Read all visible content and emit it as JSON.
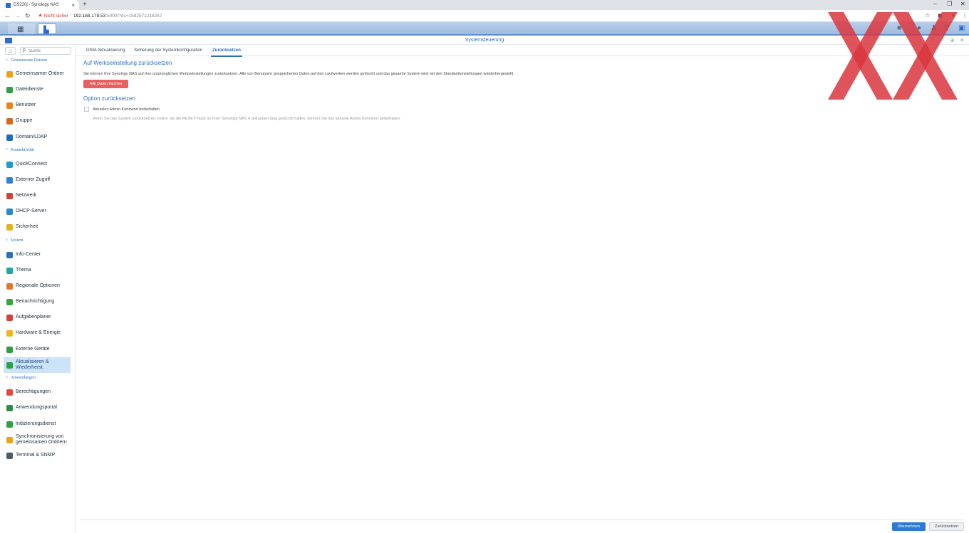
{
  "browser": {
    "tab_title": "DS220j - Synology NAS",
    "tab_close": "×",
    "new_tab": "+",
    "insecure_label": "Nicht sicher",
    "url_host": "192.168.178.53",
    "url_rest": ":5000/?dc=1582571216267",
    "window_controls": [
      "–",
      "❐",
      "✕"
    ]
  },
  "window": {
    "title": "Systemsteuerung"
  },
  "sidebar": {
    "search_placeholder": "Suche",
    "categories": {
      "shared": "Gemeinsame Dateien",
      "connectivity": "Konnektivität",
      "system": "System",
      "apps": "Anwendungen"
    },
    "items": [
      {
        "label": "Gemeinsamer Ordner",
        "color": "#e8a21f"
      },
      {
        "label": "Dateidienste",
        "color": "#2f9e44"
      },
      {
        "label": "Benutzer",
        "color": "#e8831f"
      },
      {
        "label": "Gruppe",
        "color": "#d86a20"
      },
      {
        "label": "Domain/LDAP",
        "color": "#1f6fb8"
      },
      {
        "label": "QuickConnect",
        "color": "#1e9bc9"
      },
      {
        "label": "Externer Zugriff",
        "color": "#3a7bd5"
      },
      {
        "label": "Netzwerk",
        "color": "#d0453b"
      },
      {
        "label": "DHCP-Server",
        "color": "#2c87c9"
      },
      {
        "label": "Sicherheit",
        "color": "#e3b21b"
      },
      {
        "label": "Info-Center",
        "color": "#2d6fbd"
      },
      {
        "label": "Thema",
        "color": "#1fa7a0"
      },
      {
        "label": "Regionale Optionen",
        "color": "#e0782a"
      },
      {
        "label": "Benachrichtigung",
        "color": "#3aa53a"
      },
      {
        "label": "Aufgabenplaner",
        "color": "#d0453b"
      },
      {
        "label": "Hardware & Energie",
        "color": "#f0b41e"
      },
      {
        "label": "Externe Geräte",
        "color": "#2f9e44"
      },
      {
        "label": "Aktualisieren & Wiederherst.",
        "color": "#2f9e44"
      },
      {
        "label": "Berechtigungen",
        "color": "#e04a3a"
      },
      {
        "label": "Anwendungsportal",
        "color": "#2f8a4a"
      },
      {
        "label": "Indizierungsdienst",
        "color": "#2f9e44"
      },
      {
        "label": "Synchronisierung von gemeinsamen Ordnern",
        "color": "#e8a21f"
      },
      {
        "label": "Terminal & SNMP",
        "color": "#4a5a6a"
      }
    ]
  },
  "content": {
    "tabs": [
      "DSM-Aktualisierung",
      "Sicherung der Systemkonfiguration",
      "Zurücksetzen"
    ],
    "section1_title": "Auf Werkseinstellung zurücksetzen",
    "section1_desc": "Sie können Ihre Synology NAS auf ihre ursprünglichen Werkseinstellungen zurücksetzen. Alle von Benutzern gespeicherten Daten auf den Laufwerken werden gelöscht und das gesamte System wird mit den Standardeinstellungen wiederhergestellt.",
    "erase_button": "Alle Daten löschen",
    "section2_title": "Option zurücksetzen",
    "keep_password_label": "Aktuelles Admin Kennwort beibehalten",
    "hint": "Wenn Sie das System zurücksetzen, indem Sie die RESET-Taste an Ihrer Synology NAS 4 Sekunden lang gedrückt halten, können Sie das aktuelle Admin Kennwort beibehalten.",
    "apply_button": "Übernehmen",
    "reset_button": "Zurücksetzen"
  },
  "overlay": {
    "color": "#d9363e"
  }
}
